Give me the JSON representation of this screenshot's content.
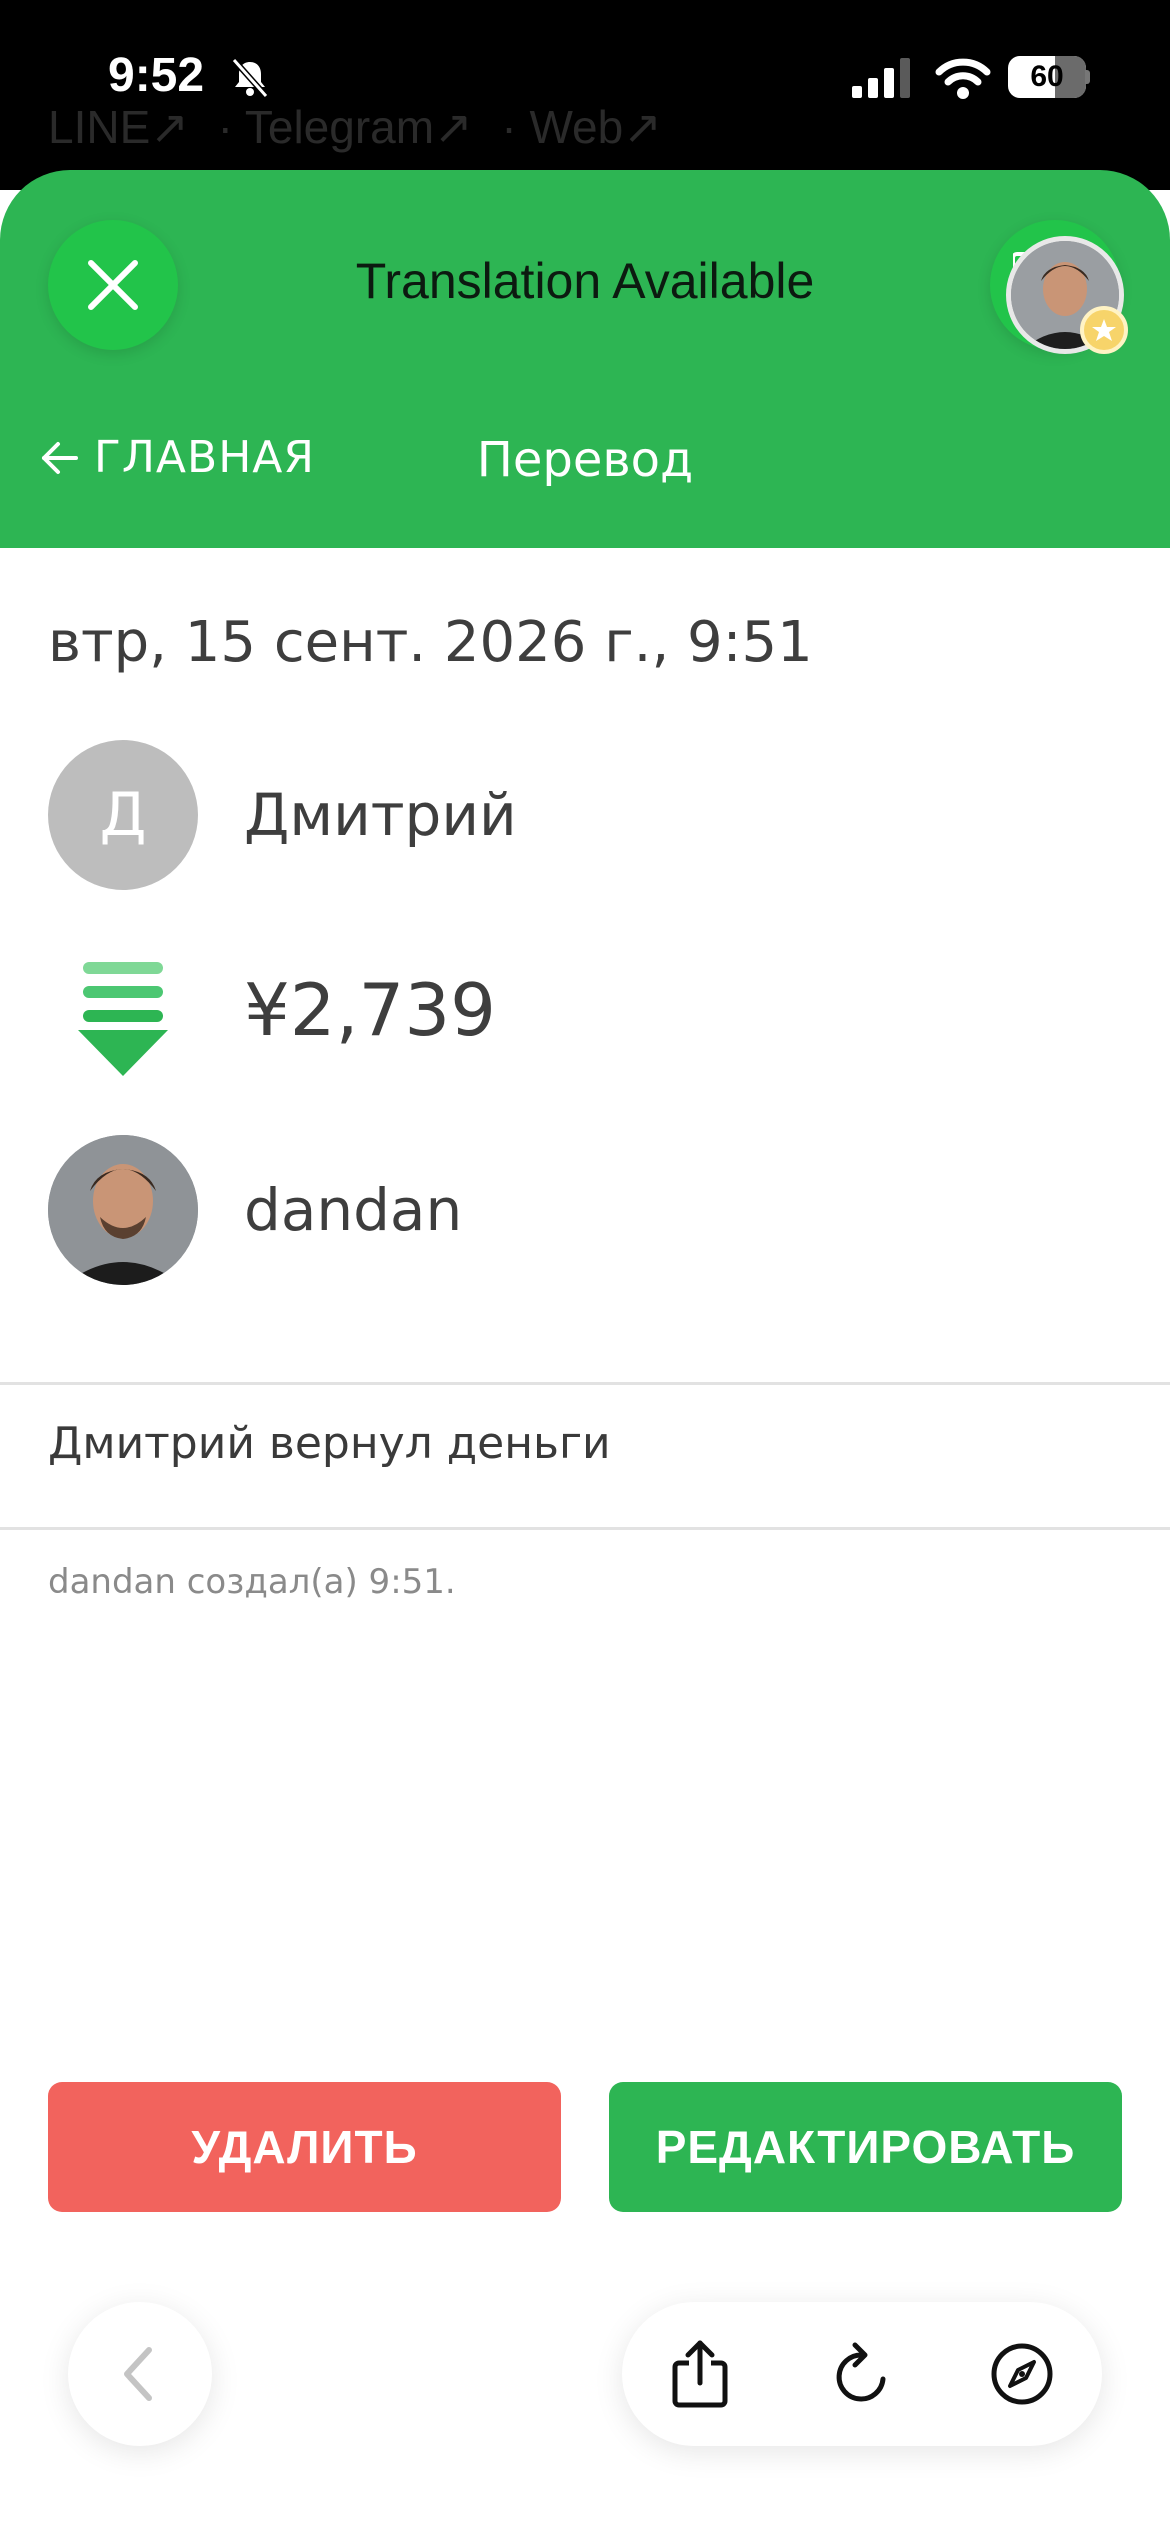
{
  "status_bar": {
    "time": "9:52",
    "battery": "60",
    "battery_level": 0.6
  },
  "background_links": [
    "LINE↗",
    "· Telegram↗",
    "· Web↗"
  ],
  "translation_banner": {
    "title": "Translation Available"
  },
  "nav": {
    "back_label": "ГЛАВНАЯ",
    "title": "Перевод"
  },
  "transaction": {
    "date": "втр, 15 сент. 2026 г., 9:51",
    "from_initial": "Д",
    "from_name": "Дмитрий",
    "amount": "¥2,739",
    "to_name": "dandan",
    "note": "Дмитрий вернул деньги",
    "created_by": "dandan создал(а) 9:51."
  },
  "actions": {
    "delete_label": "УДАЛИТЬ",
    "edit_label": "РЕДАКТИРОВАТЬ"
  },
  "colors": {
    "header_green": "#2db553",
    "delete_red": "#f2635d",
    "avatar_gray": "#bdbdbd"
  },
  "icons": {
    "close": "close-icon",
    "translate": "translate-icon",
    "back_arrow": "arrow-left-icon",
    "transfer": "transfer-down-icon",
    "share": "share-icon",
    "reload": "reload-icon",
    "compass": "compass-icon",
    "browser_back": "chevron-left-icon"
  }
}
